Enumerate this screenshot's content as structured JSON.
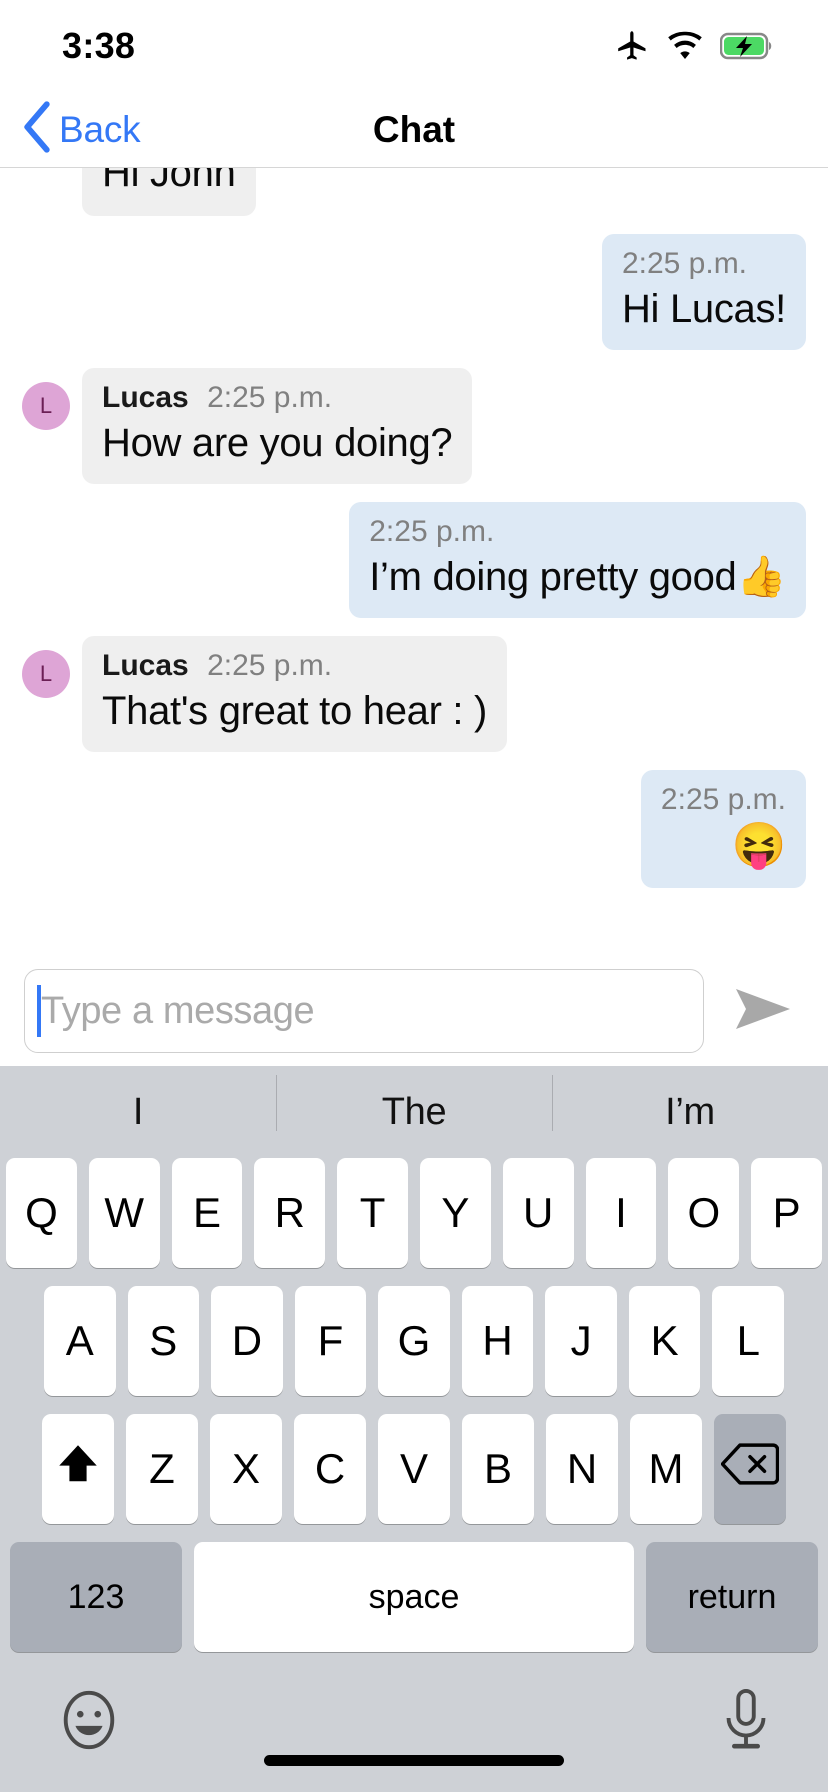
{
  "status_bar": {
    "time": "3:38",
    "icons": [
      "airplane-mode-icon",
      "wifi-icon",
      "battery-charging-icon"
    ],
    "battery_color": "#4CD964"
  },
  "nav_bar": {
    "back_label": "Back",
    "back_icon": "chevron-left-icon",
    "title": "Chat",
    "accent_color": "#3478F6"
  },
  "conversation": {
    "incoming_bubble_color": "#EFEFEF",
    "outgoing_bubble_color": "#DDE9F5",
    "avatar_color": "#DEA5D6",
    "avatar_text_color": "#6B1F55",
    "messages": [
      {
        "direction": "incoming",
        "sender": "",
        "time": "",
        "text": "Hi John",
        "avatar": "",
        "show_meta": false,
        "partial": true
      },
      {
        "direction": "outgoing",
        "sender": "",
        "time": "2:25 p.m.",
        "text": "Hi Lucas!",
        "avatar": "",
        "show_meta": true,
        "partial": false
      },
      {
        "direction": "incoming",
        "sender": "Lucas",
        "time": "2:25 p.m.",
        "text": "How are you doing?",
        "avatar": "L",
        "show_meta": true,
        "partial": false
      },
      {
        "direction": "outgoing",
        "sender": "",
        "time": "2:25 p.m.",
        "text": "I’m doing pretty good👍",
        "avatar": "",
        "show_meta": true,
        "partial": false
      },
      {
        "direction": "incoming",
        "sender": "Lucas",
        "time": "2:25 p.m.",
        "text": "That's great to hear : )",
        "avatar": "L",
        "show_meta": true,
        "partial": false
      },
      {
        "direction": "outgoing",
        "sender": "",
        "time": "2:25 p.m.",
        "text": "😝",
        "avatar": "",
        "show_meta": true,
        "partial": false,
        "emoji_only": true
      }
    ]
  },
  "composer": {
    "placeholder": "Type a message",
    "value": "",
    "send_icon": "send-arrow-icon",
    "caret_color": "#3478F6"
  },
  "keyboard": {
    "predictions": [
      "I",
      "The",
      "I’m"
    ],
    "row1": [
      "Q",
      "W",
      "E",
      "R",
      "T",
      "Y",
      "U",
      "I",
      "O",
      "P"
    ],
    "row2": [
      "A",
      "S",
      "D",
      "F",
      "G",
      "H",
      "J",
      "K",
      "L"
    ],
    "row3": [
      "Z",
      "X",
      "C",
      "V",
      "B",
      "N",
      "M"
    ],
    "shift_icon": "shift-up-arrow-icon",
    "backspace_icon": "backspace-delete-icon",
    "numbers_label": "123",
    "space_label": "space",
    "return_label": "return",
    "emoji_icon": "emoji-smiley-icon",
    "dictation_icon": "microphone-icon",
    "key_color": "#FFFFFF",
    "modifier_key_color": "#A9AEB7",
    "keyboard_bg": "#CED1D6"
  }
}
